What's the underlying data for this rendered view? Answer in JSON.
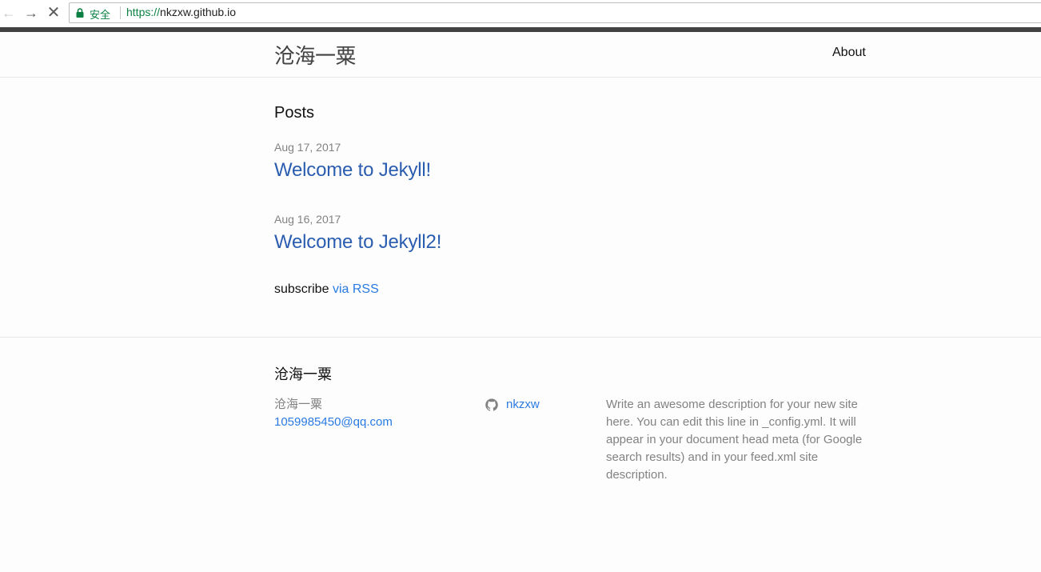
{
  "browser": {
    "nav": {
      "back_glyph": "←",
      "forward_glyph": "→",
      "stop_glyph": "✕"
    },
    "omnibox": {
      "secure_label": "安全",
      "url_scheme": "https://",
      "url_host": "nkzxw.github.io"
    },
    "loading_progress": 1.0
  },
  "header": {
    "site_title": "沧海一粟",
    "nav_links": [
      "About"
    ]
  },
  "main": {
    "heading": "Posts",
    "posts": [
      {
        "date": "Aug 17, 2017",
        "title": "Welcome to Jekyll!"
      },
      {
        "date": "Aug 16, 2017",
        "title": "Welcome to Jekyll2!"
      }
    ],
    "rss": {
      "prefix": "subscribe",
      "link_text": "via RSS"
    }
  },
  "footer": {
    "heading": "沧海一粟",
    "name": "沧海一粟",
    "email": "1059985450@qq.com",
    "github_user": "nkzxw",
    "description": "Write an awesome description for your new site here. You can edit this line in _config.yml. It will appear in your document head meta (for Google search results) and in your feed.xml site description."
  },
  "colors": {
    "link": "#2a7ae2",
    "post_title": "#2a5db0",
    "secure_green": "#0b8043",
    "meta_grey": "#828282"
  }
}
